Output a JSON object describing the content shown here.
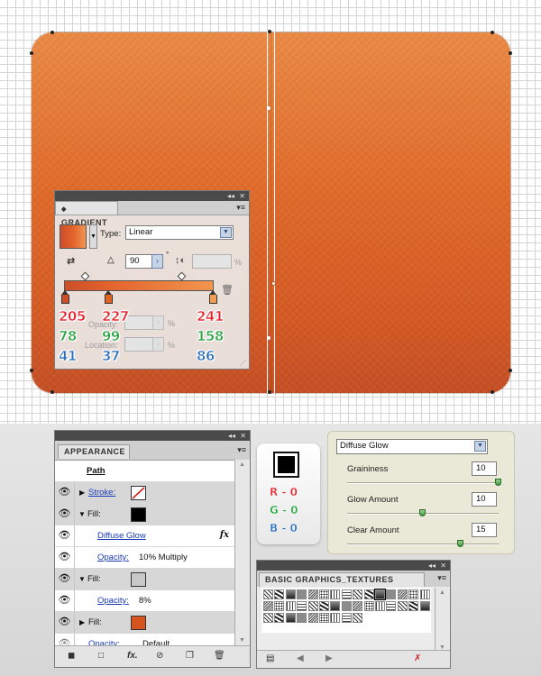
{
  "gradient_panel": {
    "title": "GRADIENT",
    "type_label": "Type:",
    "type_value": "Linear",
    "angle_value": "90",
    "aspect_value": "",
    "percent_sign": "%",
    "opacity_label": "Opacity:",
    "location_label": "Location:",
    "menu_icon": "panel-menu-icon",
    "stops": [
      {
        "r": "205",
        "g": "78",
        "b": "41",
        "color": "#cd4e29"
      },
      {
        "r": "227",
        "g": "99",
        "b": "37",
        "color": "#e36325"
      },
      {
        "r": "241",
        "g": "158",
        "b": "86",
        "color": "#f19e56"
      }
    ]
  },
  "appearance_panel": {
    "title": "APPEARANCE",
    "header": "Path",
    "rows": {
      "stroke_label": "Stroke:",
      "fill1_label": "Fill:",
      "effect_label": "Diffuse Glow",
      "opacity1_label": "Opacity:",
      "opacity1_value": "10% Multiply",
      "fill2_label": "Fill:",
      "opacity2_label": "Opacity:",
      "opacity2_value": "8%",
      "fill3_label": "Fill:",
      "opacity3_label": "Opacity:",
      "opacity3_value": "Default"
    },
    "colors": {
      "fill1": "#000000",
      "fill2": "#c8c8c8",
      "fill3": "#d8541f"
    }
  },
  "black_swatch": {
    "r_label": "R - 0",
    "g_label": "G - 0",
    "b_label": "B - 0",
    "color": "#000000"
  },
  "diffuse_glow": {
    "filter_name": "Diffuse Glow",
    "graininess_label": "Graininess",
    "graininess_value": "10",
    "graininess_level": 1.0,
    "glow_amount_label": "Glow Amount",
    "glow_amount_value": "10",
    "glow_amount_level": 0.5,
    "clear_amount_label": "Clear Amount",
    "clear_amount_value": "15",
    "clear_amount_level": 0.75
  },
  "textures_panel": {
    "title": "BASIC GRAPHICS_TEXTURES"
  },
  "colors": {
    "accent": "#e06a2a",
    "panel_bar": "#4a4a4a",
    "link": "#1a3bb8"
  }
}
